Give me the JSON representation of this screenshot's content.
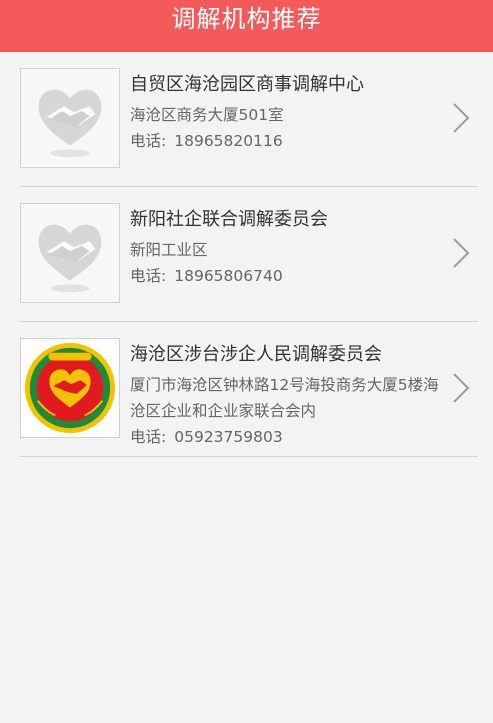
{
  "header": {
    "title": "调解机构推荐"
  },
  "institutions": [
    {
      "name": "自贸区海沧园区商事调解中心",
      "address": "海沧区商务大厦501室",
      "phone_label": "电话:",
      "phone": "18965820116",
      "logo_icon": "handshake-heart-placeholder-icon"
    },
    {
      "name": "新阳社企联合调解委员会",
      "address": "新阳工业区",
      "phone_label": "电话:",
      "phone": "18965806740",
      "logo_icon": "handshake-heart-placeholder-icon"
    },
    {
      "name": "海沧区涉台涉企人民调解委员会",
      "address": "厦门市海沧区钟林路12号海投商务大厦5楼海沧区企业和企业家联合会内",
      "phone_label": "电话:",
      "phone": "05923759803",
      "logo_icon": "people-mediation-emblem-icon"
    }
  ],
  "colors": {
    "header_bg": "#f45a5a",
    "background": "#f3f3f3",
    "divider": "#d4d4d4",
    "name_text": "#333333",
    "detail_text": "#666666",
    "emblem_red": "#e11a1f",
    "emblem_yellow": "#f3c300",
    "emblem_green": "#1e8a3b"
  }
}
